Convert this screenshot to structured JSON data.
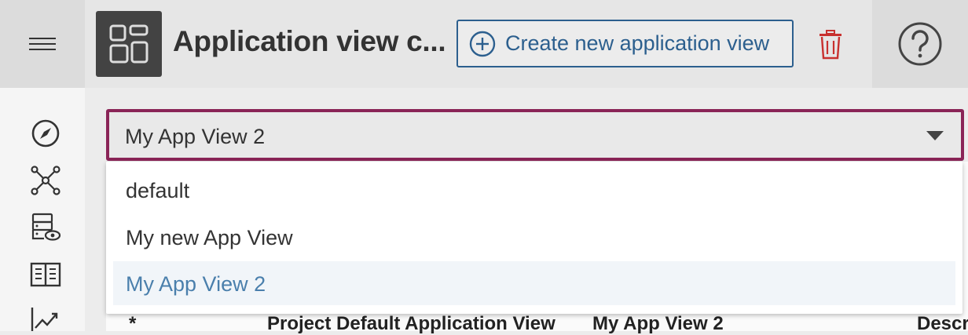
{
  "header": {
    "title": "Application view c...",
    "create_label": "Create new application view"
  },
  "select": {
    "value": "My App View 2",
    "options": [
      "default",
      "My new App View",
      "My App View 2"
    ]
  },
  "table": {
    "headers": [
      "*",
      "Project Default Application View",
      "My App View 2",
      "Descr"
    ]
  },
  "colors": {
    "accent": "#2c5f8e",
    "select_border": "#8a2457",
    "delete": "#c8312f",
    "selected_option_text": "#4a7fac"
  },
  "icons": {
    "menu": "hamburger-icon",
    "app": "app-view-icon",
    "create": "plus-circle-icon",
    "delete": "trash-icon",
    "help": "help-icon",
    "rail": [
      "compass-icon",
      "network-icon",
      "server-view-icon",
      "book-icon",
      "trend-chart-icon"
    ]
  }
}
